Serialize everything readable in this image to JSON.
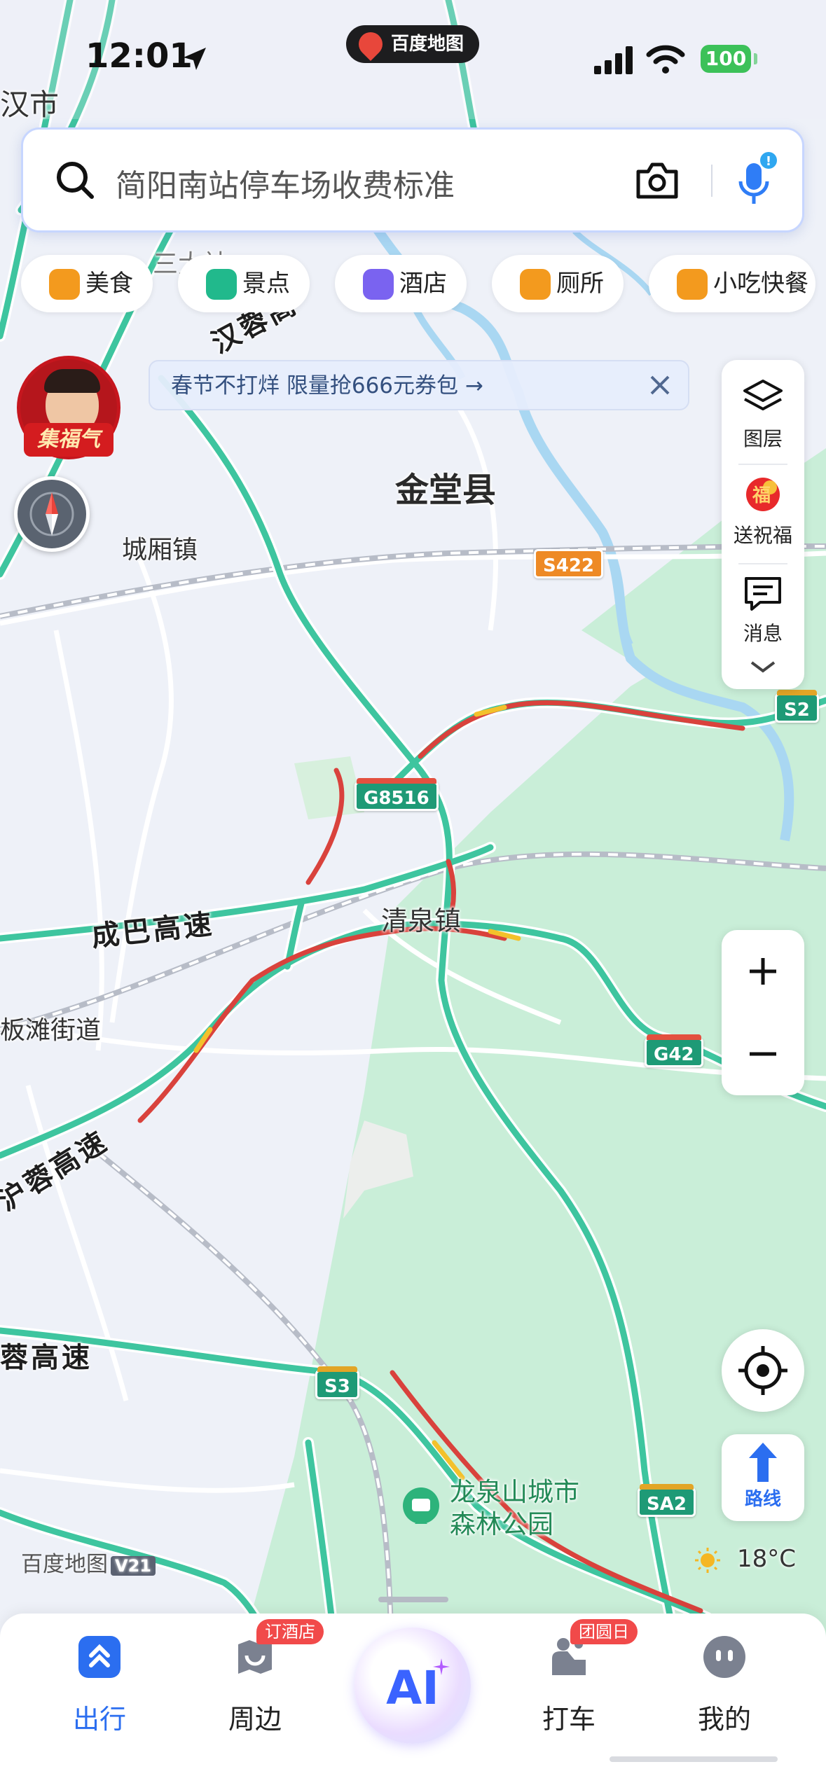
{
  "status_bar": {
    "time": "12:01",
    "app_name": "百度地图",
    "battery": "100"
  },
  "search": {
    "placeholder": "简阳南站停车场收费标准"
  },
  "categories": [
    {
      "label": "美食",
      "color": "#f39a1e"
    },
    {
      "label": "景点",
      "color": "#21b98c"
    },
    {
      "label": "酒店",
      "color": "#7a63f0"
    },
    {
      "label": "厕所",
      "color": "#f39a1e"
    },
    {
      "label": "小吃快餐",
      "color": "#f39a1e"
    }
  ],
  "promo": {
    "text": "春节不打烊 限量抢666元券包 →"
  },
  "avatar": {
    "tag": "集福气"
  },
  "side_panel": {
    "layers_label": "图层",
    "blessing_label": "送祝福",
    "message_label": "消息"
  },
  "map": {
    "labels": {
      "city_fragment": "汉市",
      "county": "金堂县",
      "town1": "城厢镇",
      "town2": "清泉镇",
      "street": "板滩街道",
      "park": "龙泉山城市\n森林公园",
      "fragment_top": "三大社"
    },
    "roads": {
      "chengba": "成巴高速",
      "hurong": "沪蓉高速",
      "rong_lower": "蓉高速",
      "hanrong": "汉蓉高"
    },
    "shields": {
      "s422": "S422",
      "s2": "S2",
      "g8516": "G8516",
      "g42": "G42",
      "s3": "S3",
      "sa2": "SA2"
    },
    "colors": {
      "water": "#a9d7f2",
      "forest": "#c6ecd5",
      "highway": "#3ec59f",
      "congestion": "#d9423c",
      "slow": "#f3c12b"
    }
  },
  "controls": {
    "zoom_in": "+",
    "zoom_out": "−",
    "route_label": "路线"
  },
  "footer": {
    "logo": "百度地图",
    "scale": "V21",
    "weather": "18°C"
  },
  "tabs": [
    {
      "label": "出行",
      "active": true
    },
    {
      "label": "周边",
      "badge": "订酒店"
    },
    {
      "label": "AI"
    },
    {
      "label": "打车",
      "badge": "团圆日"
    },
    {
      "label": "我的"
    }
  ]
}
